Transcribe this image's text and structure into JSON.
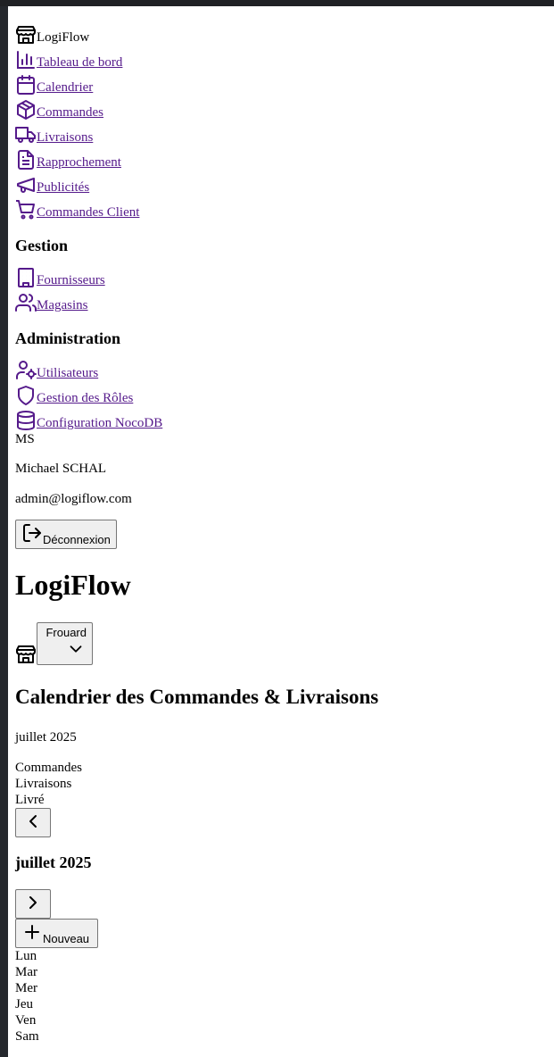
{
  "sidebar": {
    "brand": "LogiFlow",
    "nav_items": [
      {
        "label": "Tableau de bord",
        "icon": "bar-chart-icon"
      },
      {
        "label": "Calendrier",
        "icon": "calendar-icon"
      },
      {
        "label": "Commandes",
        "icon": "package-icon"
      },
      {
        "label": "Livraisons",
        "icon": "truck-icon"
      },
      {
        "label": "Rapprochement",
        "icon": "file-text-icon"
      },
      {
        "label": "Publicités",
        "icon": "megaphone-icon"
      },
      {
        "label": "Commandes Client",
        "icon": "cart-icon"
      }
    ],
    "gestion_heading": "Gestion",
    "gestion_items": [
      {
        "label": "Fournisseurs",
        "icon": "building-icon"
      },
      {
        "label": "Magasins",
        "icon": "users-icon"
      }
    ],
    "admin_heading": "Administration",
    "admin_items": [
      {
        "label": "Utilisateurs",
        "icon": "user-cog-icon"
      },
      {
        "label": "Gestion des Rôles",
        "icon": "shield-icon"
      },
      {
        "label": "Configuration NocoDB",
        "icon": "database-icon"
      }
    ],
    "user": {
      "initials": "MS",
      "name": "Michael SCHAL",
      "email": "admin@logiflow.com"
    },
    "logout_label": "Déconnexion"
  },
  "header": {
    "title": "LogiFlow",
    "store_selected": "Frouard"
  },
  "calendar": {
    "title": "Calendrier des Commandes & Livraisons",
    "subtitle_month": "juillet 2025",
    "legend": [
      "Commandes",
      "Livraisons",
      "Livré"
    ],
    "current_month": "juillet 2025",
    "new_label": "Nouveau",
    "weekdays": [
      "Lun",
      "Mar",
      "Mer",
      "Jeu",
      "Ven",
      "Sam"
    ]
  },
  "colors": {
    "link": "#551a8b",
    "accent": "#f08a00",
    "background": "#ffffff"
  }
}
